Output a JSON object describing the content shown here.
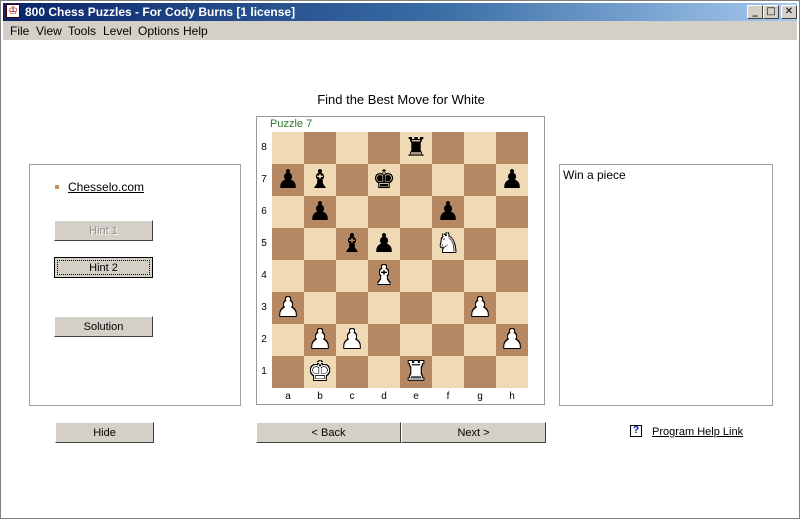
{
  "window": {
    "title": "800 Chess Puzzles - For Cody Burns [1 license]",
    "icon_glyph": "♔",
    "controls": {
      "minimize": "_",
      "maximize": "□",
      "close": "✕"
    }
  },
  "menu": [
    "File",
    "View",
    "Tools",
    "Level",
    "Options",
    "Help"
  ],
  "prompt": "Find the Best Move for White",
  "puzzle_label": "Puzzle 7",
  "left_panel": {
    "site_link": "Chesselo.com",
    "hint1_label": "Hint 1",
    "hint2_label": "Hint 2",
    "solution_label": "Solution"
  },
  "hint_text": "Win a piece",
  "buttons": {
    "hide": "Hide",
    "back": "< Back",
    "next": "Next >"
  },
  "help_link": "Program Help Link",
  "help_icon_glyph": "?",
  "board": {
    "ranks": [
      "8",
      "7",
      "6",
      "5",
      "4",
      "3",
      "2",
      "1"
    ],
    "files": [
      "a",
      "b",
      "c",
      "d",
      "e",
      "f",
      "g",
      "h"
    ],
    "light_color": "#f0d9b5",
    "dark_color": "#b58863",
    "pieces": [
      {
        "square": "e8",
        "color": "black",
        "type": "rook",
        "glyph": "♜"
      },
      {
        "square": "a7",
        "color": "black",
        "type": "pawn",
        "glyph": "♟"
      },
      {
        "square": "b7",
        "color": "black",
        "type": "bishop",
        "glyph": "♝"
      },
      {
        "square": "d7",
        "color": "black",
        "type": "king",
        "glyph": "♚"
      },
      {
        "square": "h7",
        "color": "black",
        "type": "pawn",
        "glyph": "♟"
      },
      {
        "square": "b6",
        "color": "black",
        "type": "pawn",
        "glyph": "♟"
      },
      {
        "square": "f6",
        "color": "black",
        "type": "pawn",
        "glyph": "♟"
      },
      {
        "square": "c5",
        "color": "black",
        "type": "bishop",
        "glyph": "♝"
      },
      {
        "square": "d5",
        "color": "black",
        "type": "pawn",
        "glyph": "♟"
      },
      {
        "square": "f5",
        "color": "white",
        "type": "knight",
        "glyph": "♞"
      },
      {
        "square": "d4",
        "color": "white",
        "type": "bishop",
        "glyph": "♝"
      },
      {
        "square": "a3",
        "color": "white",
        "type": "pawn",
        "glyph": "♟"
      },
      {
        "square": "g3",
        "color": "white",
        "type": "pawn",
        "glyph": "♟"
      },
      {
        "square": "b2",
        "color": "white",
        "type": "pawn",
        "glyph": "♟"
      },
      {
        "square": "c2",
        "color": "white",
        "type": "pawn",
        "glyph": "♟"
      },
      {
        "square": "h2",
        "color": "white",
        "type": "pawn",
        "glyph": "♟"
      },
      {
        "square": "b1",
        "color": "white",
        "type": "king",
        "glyph": "♚"
      },
      {
        "square": "e1",
        "color": "white",
        "type": "rook",
        "glyph": "♜"
      }
    ]
  }
}
